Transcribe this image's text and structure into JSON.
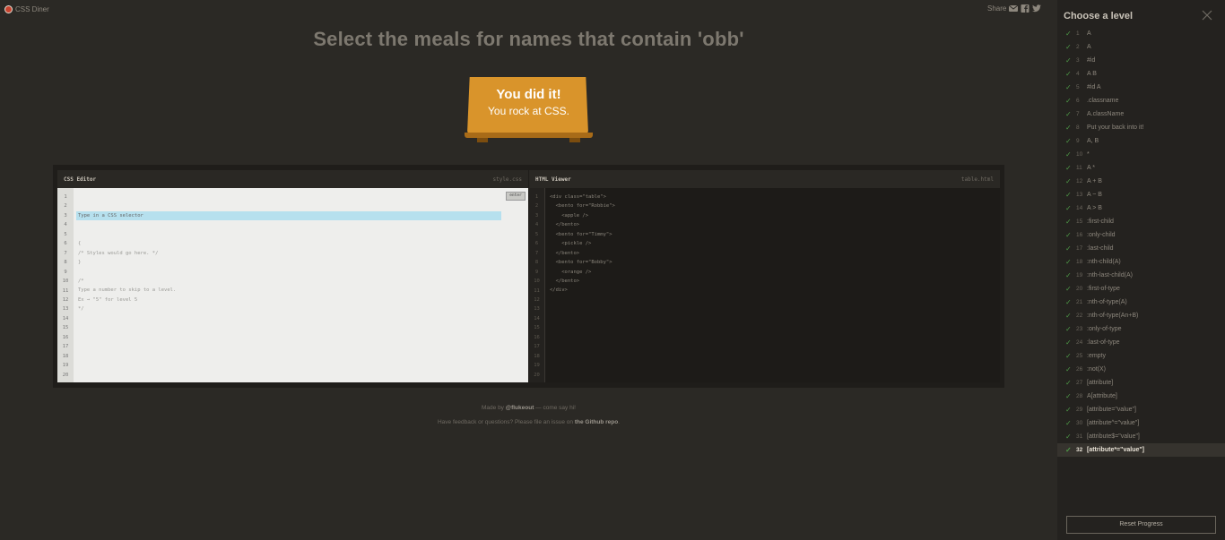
{
  "header": {
    "brand": "CSS Diner",
    "share_label": "Share",
    "share_icons": [
      "mail-icon",
      "facebook-icon",
      "twitter-icon"
    ]
  },
  "title": "Select the meals for names that contain 'obb'",
  "plate": {
    "line1": "You did it!",
    "line2": "You rock at CSS."
  },
  "css_editor": {
    "title": "CSS Editor",
    "file": "style.css",
    "input_placeholder": "Type in a CSS selector",
    "enter_label": "enter",
    "lines": [
      "{",
      "/* Styles would go here. */",
      "}",
      "",
      "/*",
      "Type a number to skip to a level.",
      "Ex → \"5\" for level 5",
      "*/"
    ],
    "line_numbers": [
      "1",
      "2",
      "3",
      "4",
      "5",
      "6",
      "7",
      "8",
      "9",
      "10",
      "11",
      "12",
      "13",
      "14",
      "15",
      "16",
      "17",
      "18",
      "19",
      "20"
    ]
  },
  "html_viewer": {
    "title": "HTML Viewer",
    "file": "table.html",
    "lines": [
      "<div class=\"table\">",
      "  <bento for=\"Robbie\">",
      "    <apple />",
      "  </bento>",
      "  <bento for=\"Timmy\">",
      "    <pickle />",
      "  </bento>",
      "  <bento for=\"Bobby\">",
      "    <orange />",
      "  </bento>",
      "</div>"
    ],
    "line_numbers": [
      "1",
      "2",
      "3",
      "4",
      "5",
      "6",
      "7",
      "8",
      "9",
      "10",
      "11",
      "12",
      "13",
      "14",
      "15",
      "16",
      "17",
      "18",
      "19",
      "20"
    ]
  },
  "footer": {
    "made_by_prefix": "Made by ",
    "made_by_name": "@flukeout",
    "made_by_suffix": " — come say hi!",
    "feedback_prefix": "Have feedback or questions? Please file an issue on ",
    "feedback_link": "the Github repo",
    "feedback_suffix": "."
  },
  "sidebar": {
    "title": "Choose a level",
    "reset_label": "Reset Progress",
    "current_level": 32,
    "levels": [
      {
        "num": "1",
        "label": "A"
      },
      {
        "num": "2",
        "label": "A"
      },
      {
        "num": "3",
        "label": "#id"
      },
      {
        "num": "4",
        "label": "A B"
      },
      {
        "num": "5",
        "label": "#id A"
      },
      {
        "num": "6",
        "label": ".classname"
      },
      {
        "num": "7",
        "label": "A.className"
      },
      {
        "num": "8",
        "label": "Put your back into it!"
      },
      {
        "num": "9",
        "label": "A, B"
      },
      {
        "num": "10",
        "label": "*"
      },
      {
        "num": "11",
        "label": "A *"
      },
      {
        "num": "12",
        "label": "A + B"
      },
      {
        "num": "13",
        "label": "A ~ B"
      },
      {
        "num": "14",
        "label": "A > B"
      },
      {
        "num": "15",
        "label": ":first-child"
      },
      {
        "num": "16",
        "label": ":only-child"
      },
      {
        "num": "17",
        "label": ":last-child"
      },
      {
        "num": "18",
        "label": ":nth-child(A)"
      },
      {
        "num": "19",
        "label": ":nth-last-child(A)"
      },
      {
        "num": "20",
        "label": ":first-of-type"
      },
      {
        "num": "21",
        "label": ":nth-of-type(A)"
      },
      {
        "num": "22",
        "label": ":nth-of-type(An+B)"
      },
      {
        "num": "23",
        "label": ":only-of-type"
      },
      {
        "num": "24",
        "label": ":last-of-type"
      },
      {
        "num": "25",
        "label": ":empty"
      },
      {
        "num": "26",
        "label": ":not(X)"
      },
      {
        "num": "27",
        "label": "[attribute]"
      },
      {
        "num": "28",
        "label": "A[attribute]"
      },
      {
        "num": "29",
        "label": "[attribute=\"value\"]"
      },
      {
        "num": "30",
        "label": "[attribute^=\"value\"]"
      },
      {
        "num": "31",
        "label": "[attribute$=\"value\"]"
      },
      {
        "num": "32",
        "label": "[attribute*=\"value\"]"
      }
    ]
  }
}
